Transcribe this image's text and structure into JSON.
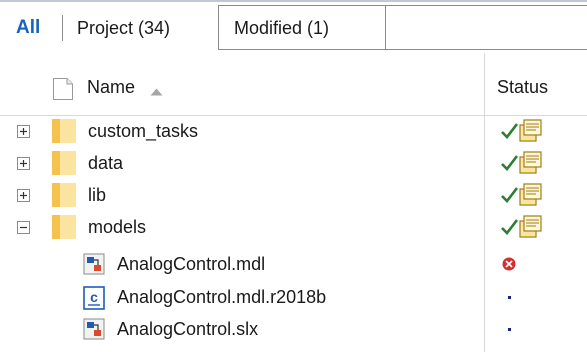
{
  "filter_tabs": {
    "all": "All",
    "project": "Project (34)",
    "modified": "Modified (1)"
  },
  "search": {
    "value": "",
    "placeholder": ""
  },
  "columns": {
    "name": "Name",
    "status": "Status",
    "sort": "ascending"
  },
  "colors": {
    "accent": "#1565c0",
    "folder": "#f7c948",
    "check": "#2e7d32",
    "error": "#d32f2f"
  },
  "rows": [
    {
      "type": "folder",
      "name": "custom_tasks",
      "expander": "plus-box-icon",
      "status": [
        "check-icon",
        "project-folder-icon"
      ]
    },
    {
      "type": "folder",
      "name": "data",
      "expander": "plus-box-icon",
      "status": [
        "check-icon",
        "project-folder-icon"
      ]
    },
    {
      "type": "folder",
      "name": "lib",
      "expander": "plus-box-icon",
      "status": [
        "check-icon",
        "project-folder-icon"
      ]
    },
    {
      "type": "folder",
      "name": "models",
      "expander": "minus-box-icon",
      "status": [
        "check-icon",
        "project-folder-icon"
      ]
    },
    {
      "type": "file",
      "name": "AnalogControl.mdl",
      "icon": "simulink-model-icon",
      "status": [
        "error-icon"
      ]
    },
    {
      "type": "file",
      "name": "AnalogControl.mdl.r2018b",
      "icon": "code-file-icon",
      "status": [
        "dot-icon"
      ]
    },
    {
      "type": "file",
      "name": "AnalogControl.slx",
      "icon": "simulink-model-icon",
      "status": [
        "dot-icon"
      ]
    }
  ]
}
